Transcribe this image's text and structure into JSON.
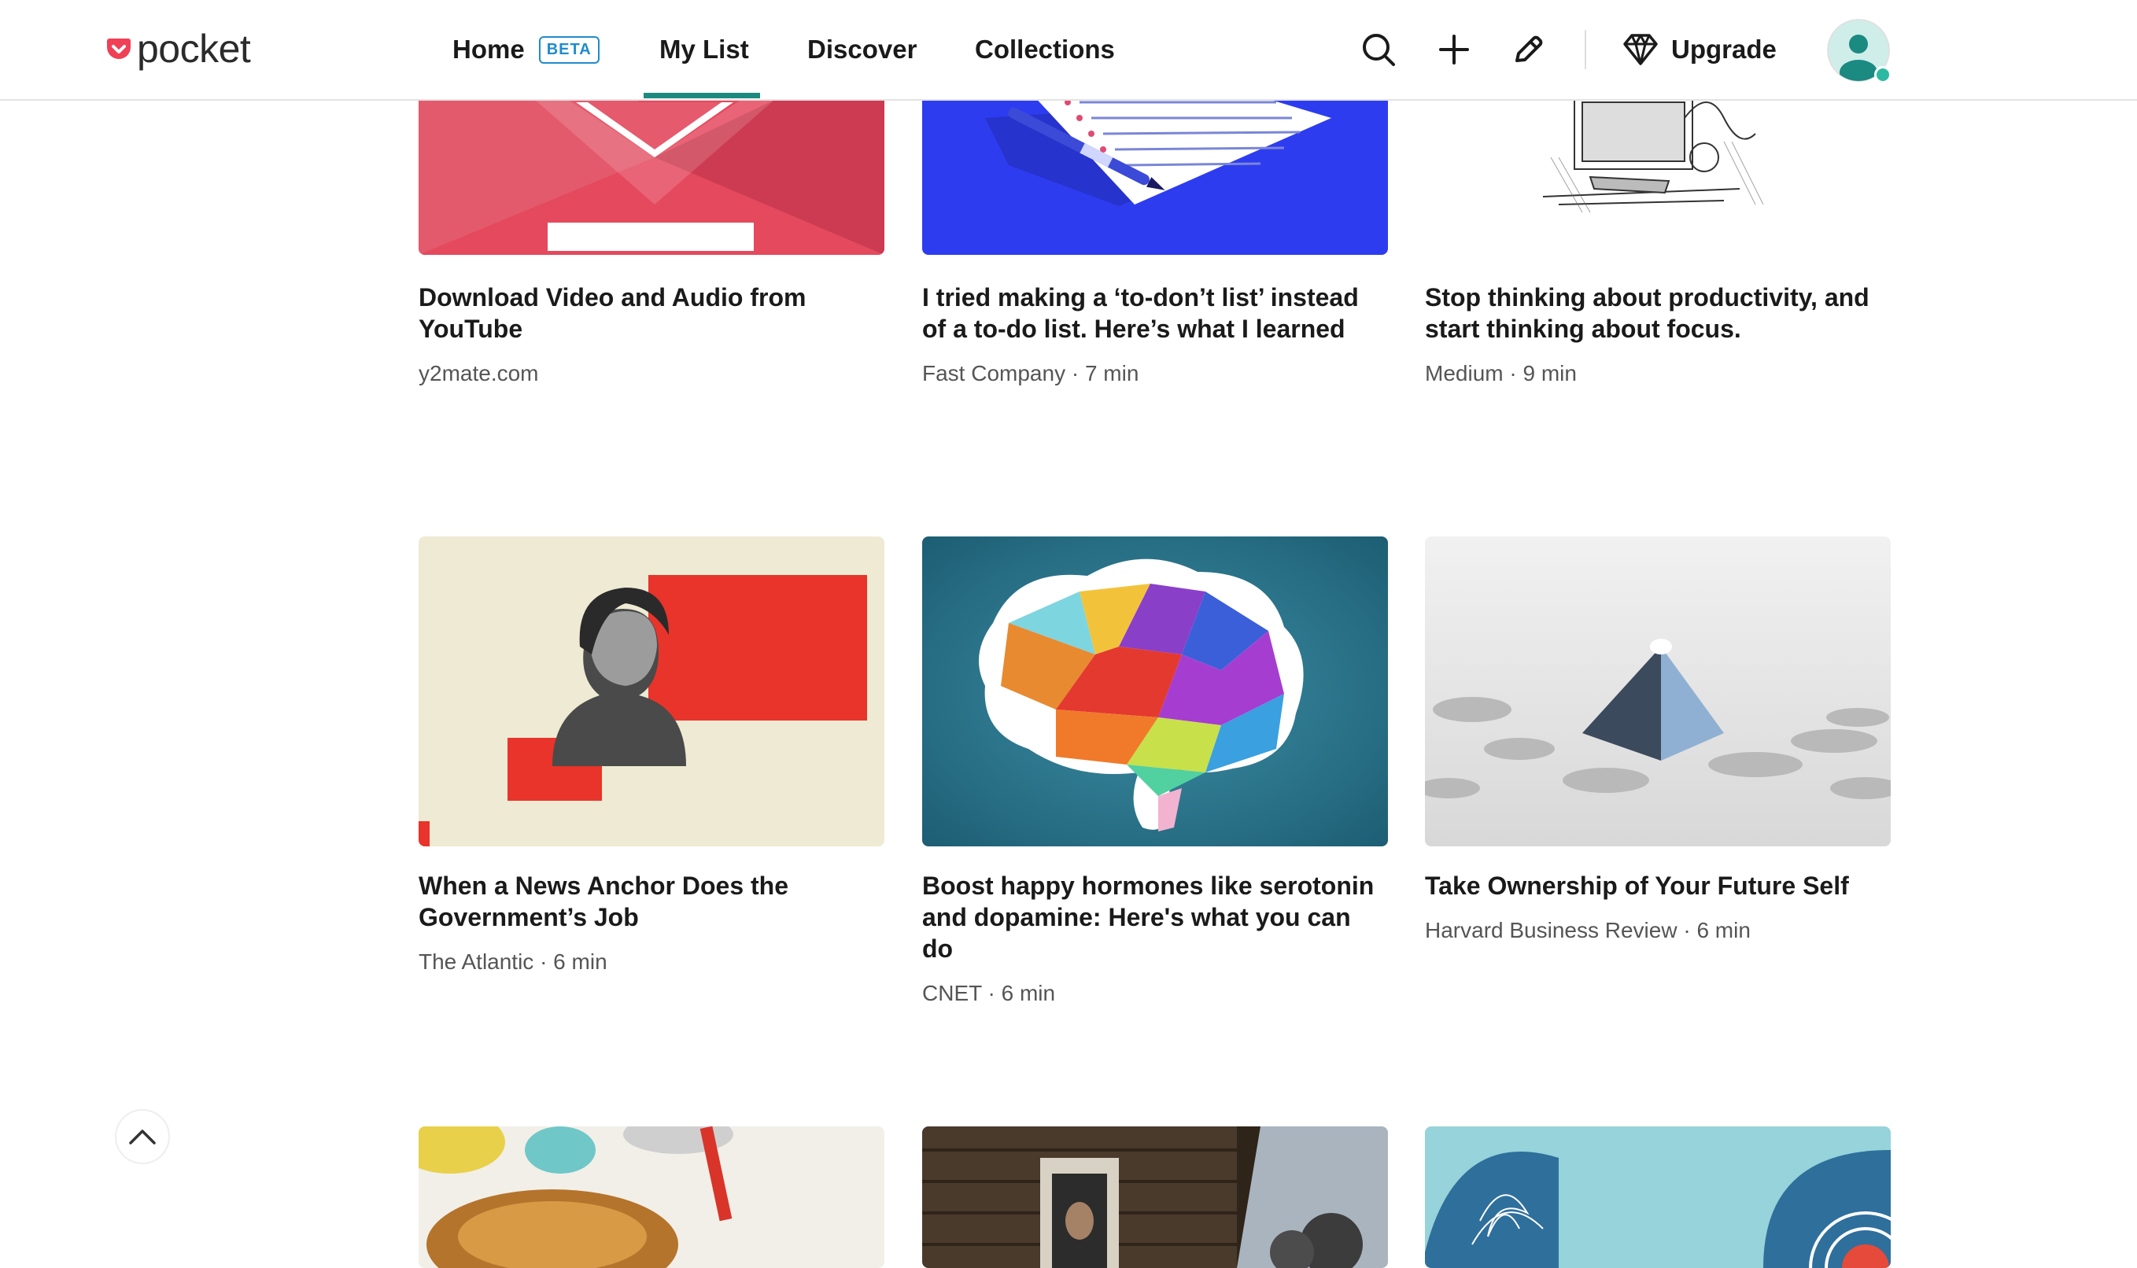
{
  "header": {
    "logo_text": "pocket",
    "nav": {
      "home_label": "Home",
      "home_badge": "BETA",
      "mylist_label": "My List",
      "discover_label": "Discover",
      "collections_label": "Collections"
    },
    "upgrade_label": "Upgrade"
  },
  "articles": [
    {
      "title": "Download Video and Audio from YouTube",
      "meta": "y2mate.com"
    },
    {
      "title": "I tried making a ‘to-don’t list’ instead of a to-do list. Here’s what I learned",
      "meta": "Fast Company · 7 min"
    },
    {
      "title": "Stop thinking about productivity, and start thinking about focus.",
      "meta": "Medium · 9 min"
    },
    {
      "title": "When a News Anchor Does the Government’s Job",
      "meta": "The Atlantic · 6 min"
    },
    {
      "title": "Boost happy hormones like serotonin and dopamine: Here's what you can do",
      "meta": "CNET · 6 min"
    },
    {
      "title": "Take Ownership of Your Future Self",
      "meta": "Harvard Business Review · 6 min"
    }
  ],
  "colors": {
    "accent": "#1d8a80",
    "brand": "#ef4056",
    "beta": "#1f8ccc"
  },
  "icons": {
    "search": "search-icon",
    "add": "plus-icon",
    "highlight": "pencil-icon",
    "upgrade": "diamond-icon",
    "scroll_top": "chevron-up-icon"
  }
}
